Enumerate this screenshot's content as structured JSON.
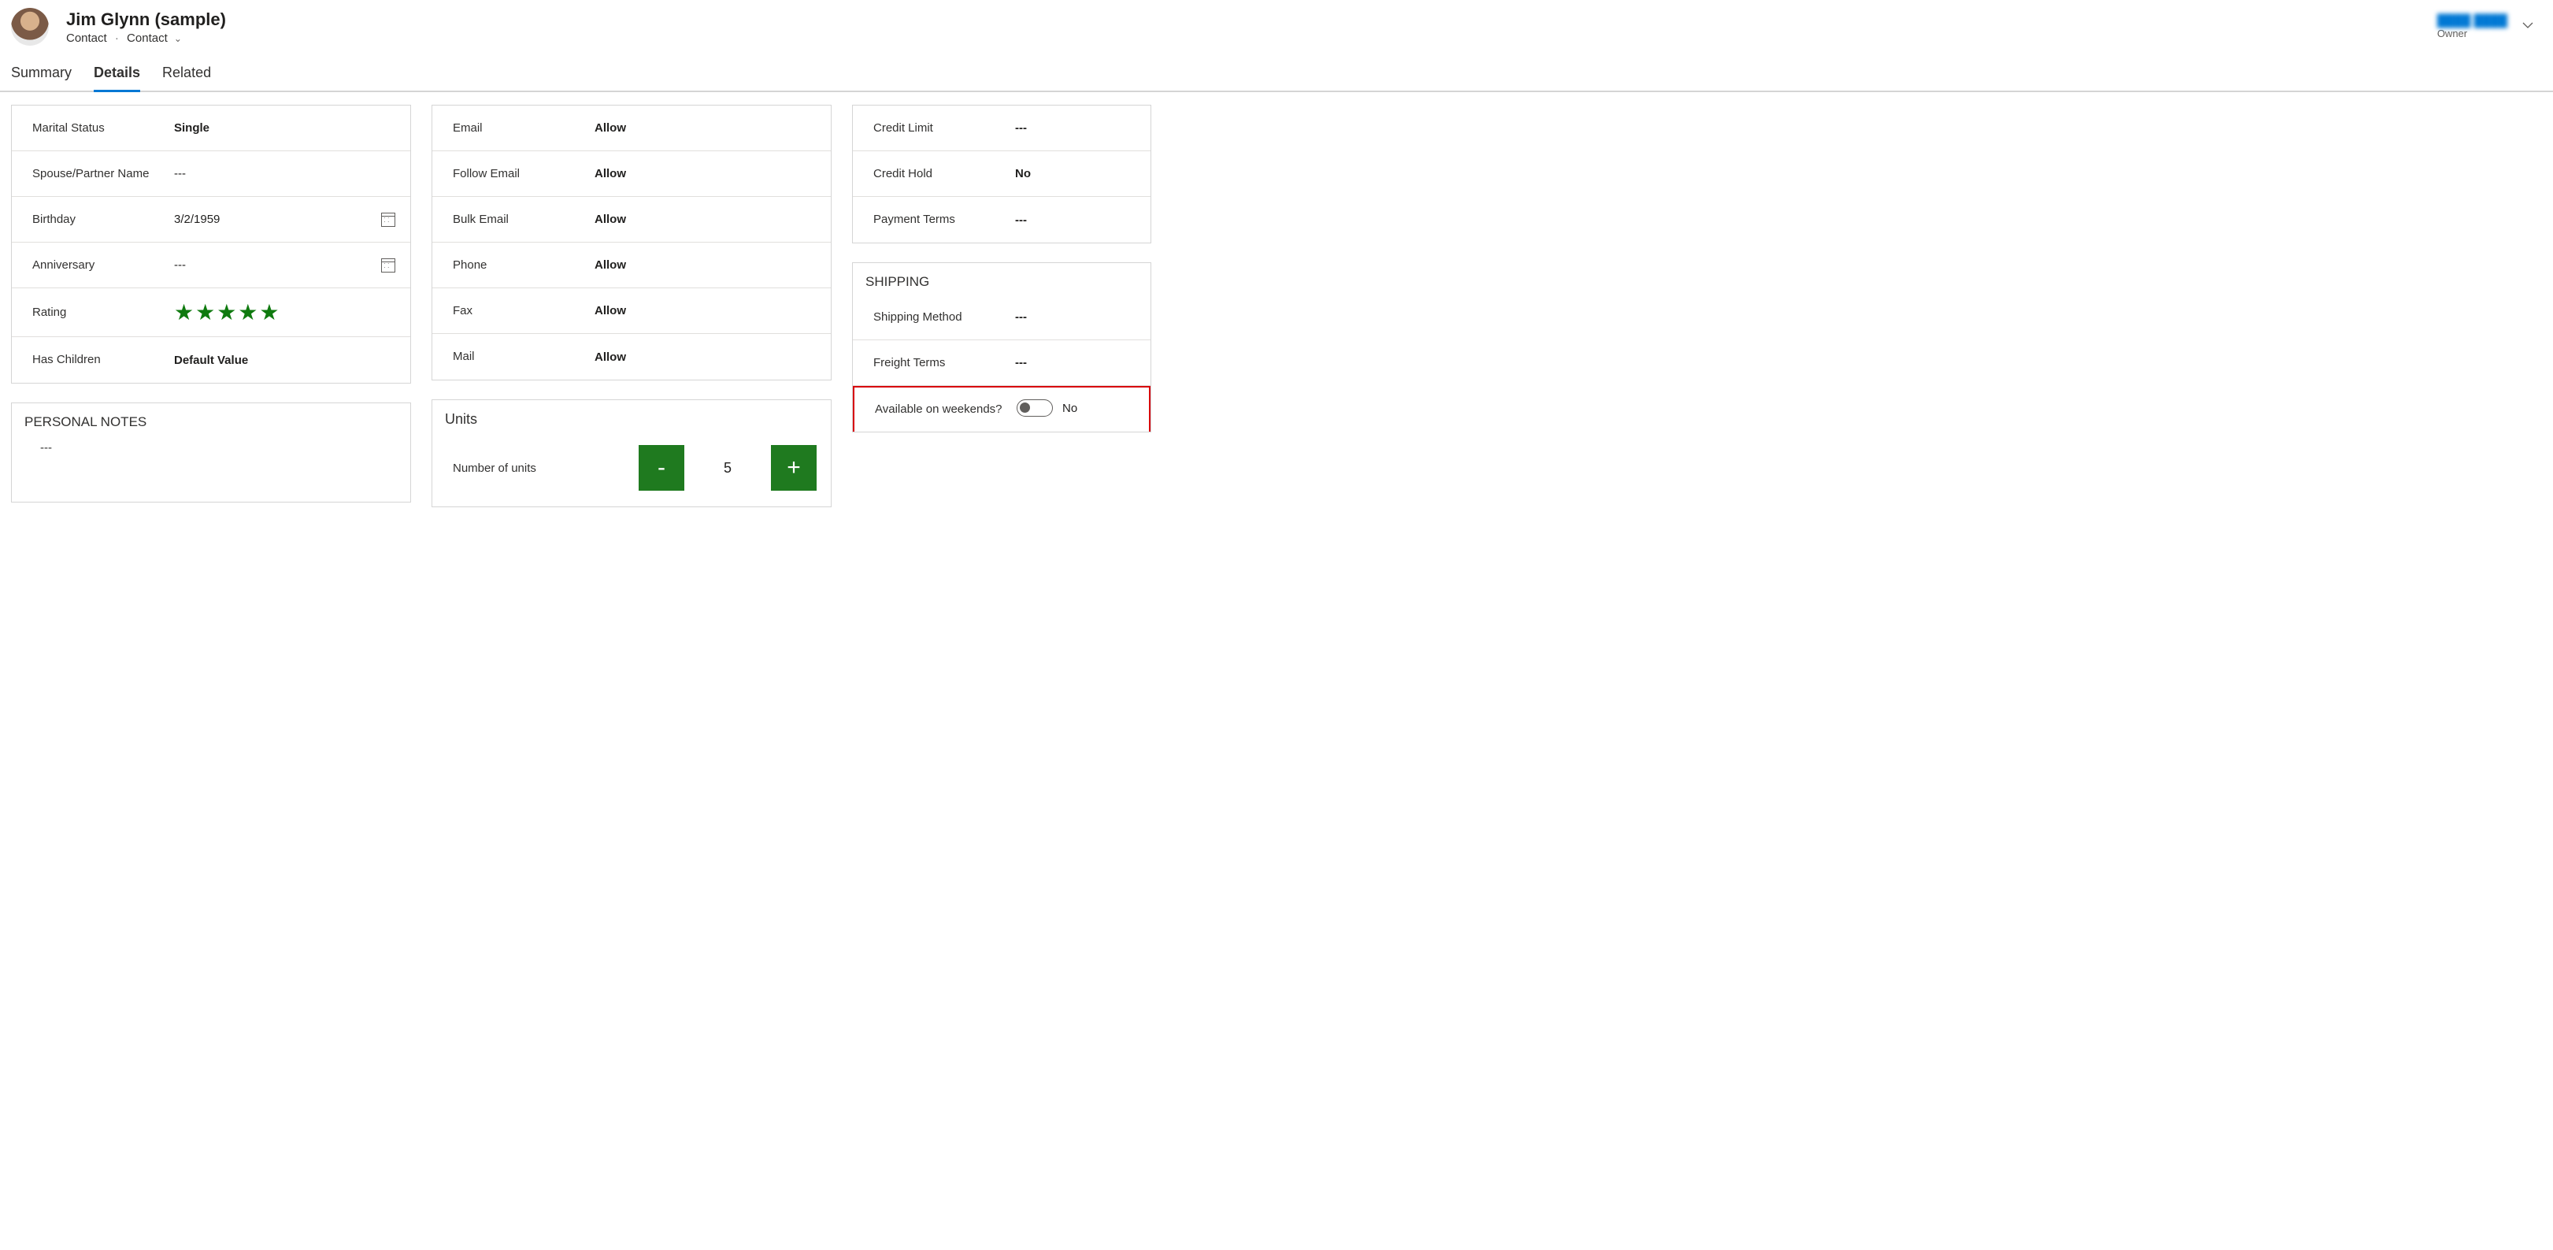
{
  "header": {
    "name": "Jim Glynn (sample)",
    "entity": "Contact",
    "form": "Contact",
    "owner_name": "████ ████",
    "owner_label": "Owner"
  },
  "tabs": {
    "summary": "Summary",
    "details": "Details",
    "related": "Related"
  },
  "personal": {
    "marital_status_label": "Marital Status",
    "marital_status_value": "Single",
    "spouse_label": "Spouse/Partner Name",
    "spouse_value": "---",
    "birthday_label": "Birthday",
    "birthday_value": "3/2/1959",
    "anniversary_label": "Anniversary",
    "anniversary_value": "---",
    "rating_label": "Rating",
    "rating_stars": "★★★★★",
    "has_children_label": "Has Children",
    "has_children_value": "Default Value"
  },
  "notes": {
    "title": "PERSONAL NOTES",
    "value": "---"
  },
  "contact_prefs": {
    "email_label": "Email",
    "email_value": "Allow",
    "follow_email_label": "Follow Email",
    "follow_email_value": "Allow",
    "bulk_email_label": "Bulk Email",
    "bulk_email_value": "Allow",
    "phone_label": "Phone",
    "phone_value": "Allow",
    "fax_label": "Fax",
    "fax_value": "Allow",
    "mail_label": "Mail",
    "mail_value": "Allow"
  },
  "units": {
    "title": "Units",
    "label": "Number of units",
    "minus": "-",
    "plus": "+",
    "value": "5"
  },
  "billing": {
    "credit_limit_label": "Credit Limit",
    "credit_limit_value": "---",
    "credit_hold_label": "Credit Hold",
    "credit_hold_value": "No",
    "payment_terms_label": "Payment Terms",
    "payment_terms_value": "---"
  },
  "shipping": {
    "title": "SHIPPING",
    "method_label": "Shipping Method",
    "method_value": "---",
    "freight_label": "Freight Terms",
    "freight_value": "---",
    "weekends_label": "Available on weekends?",
    "weekends_value": "No"
  }
}
